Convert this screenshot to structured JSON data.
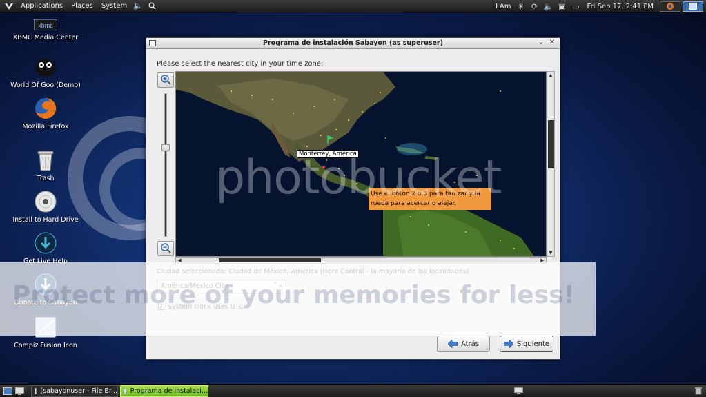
{
  "top_panel": {
    "menus": [
      "Applications",
      "Places",
      "System"
    ],
    "keyboard": "LAm",
    "clock": "Fri Sep 17,  2:41 PM"
  },
  "desktop_icons": [
    {
      "label": "XBMC Media Center",
      "icon": "xbmc-icon"
    },
    {
      "label": "World Of Goo (Demo)",
      "icon": "goo-ball-icon"
    },
    {
      "label": "Mozilla Firefox",
      "icon": "firefox-icon"
    },
    {
      "label": "Trash",
      "icon": "trash-icon"
    },
    {
      "label": "Install to Hard Drive",
      "icon": "cd-icon"
    },
    {
      "label": "Get Live Help",
      "icon": "help-icon"
    },
    {
      "label": "Donate to Sabayon",
      "icon": "donate-icon"
    },
    {
      "label": "Compiz Fusion Icon",
      "icon": "compiz-icon"
    }
  ],
  "window": {
    "title": "Programa de instalación Sabayon (as superuser)",
    "prompt": "Please select the nearest city in your time zone:",
    "map": {
      "hover_city": "Monterrey, América",
      "tooltip": "Use el botón 2 o 3 para tan zar y la rueda para acercar o alejar."
    },
    "selected_city": "Ciudad seleccionada: Ciudad de México, América (Hora Central - la mayoría de las localidades)",
    "timezone_value": "América/Mexico City",
    "system_clock_label": "System clock uses UTC",
    "system_clock_checked": true,
    "back_label": "Atrás",
    "next_label": "Siguiente"
  },
  "watermark": {
    "brand": "photobucket",
    "band_text": "Protect more of your memories for less!"
  },
  "taskbar": {
    "tasks": [
      {
        "label": "[sabayonuser - File Br...",
        "active": false
      },
      {
        "label": "Programa de instalaci...",
        "active": true
      }
    ]
  }
}
